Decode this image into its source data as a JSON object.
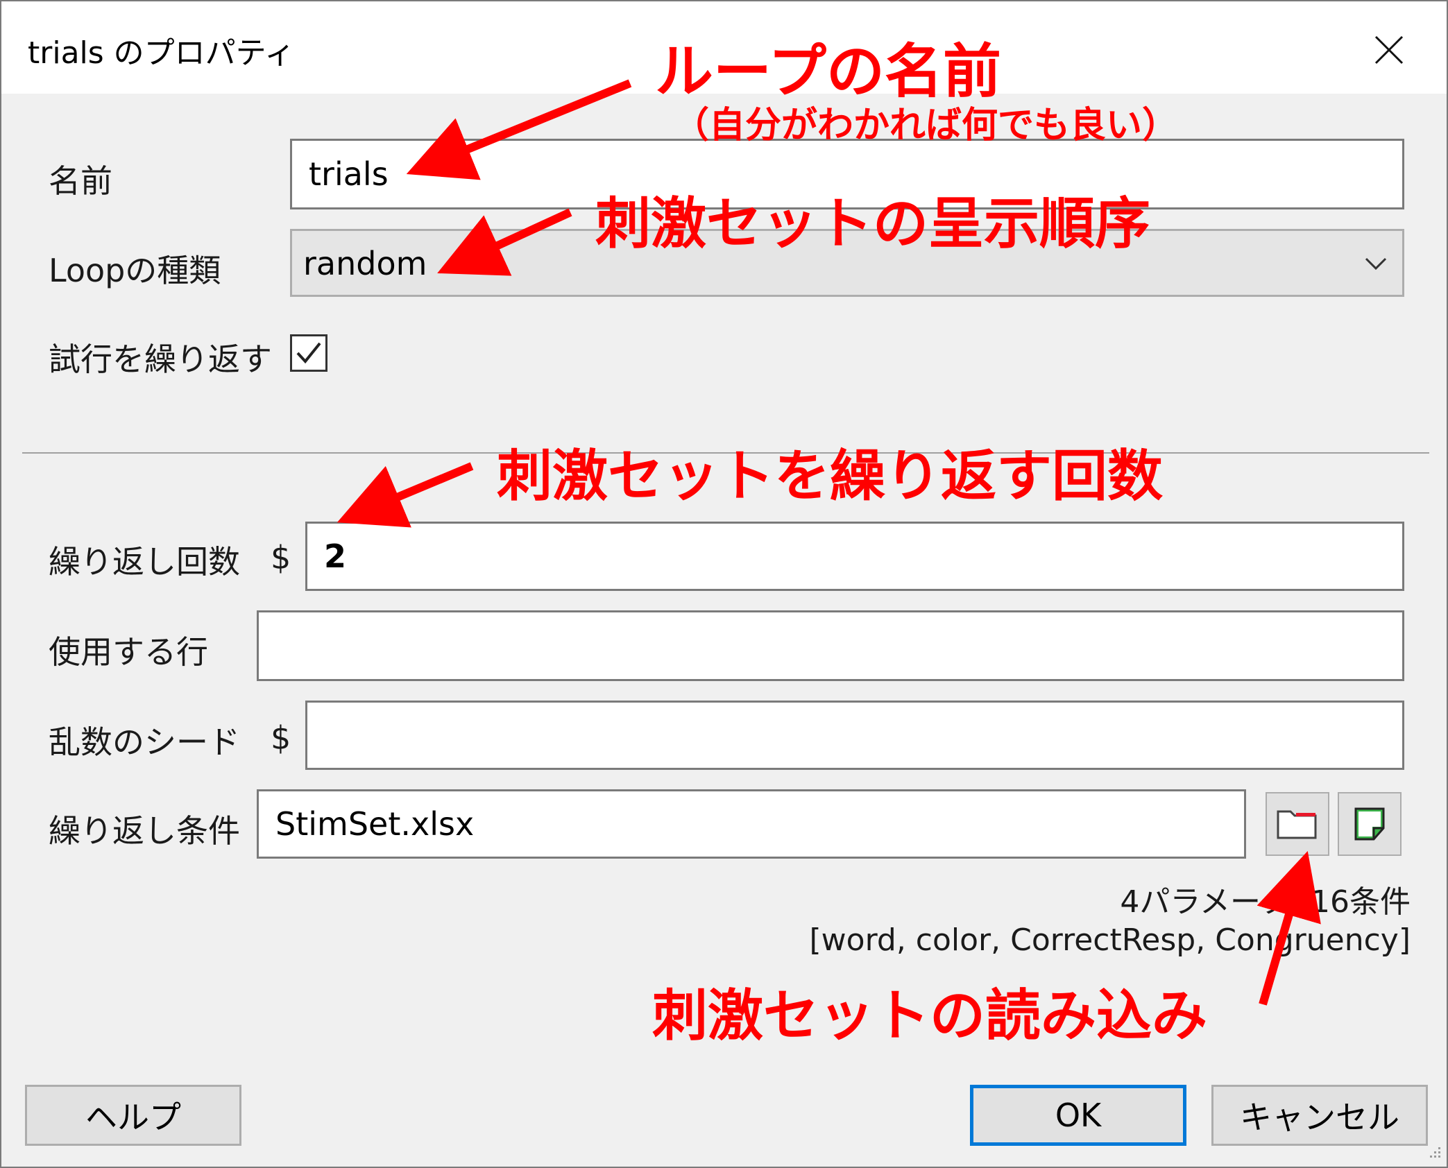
{
  "window": {
    "title": "trials のプロパティ"
  },
  "fields": {
    "name": {
      "label": "名前",
      "value": "trials"
    },
    "loop_type": {
      "label": "Loopの種類",
      "value": "random"
    },
    "repeat_trials": {
      "label": "試行を繰り返す",
      "checked": true
    },
    "nreps": {
      "label": "繰り返し回数",
      "dollar": "$",
      "value": "2"
    },
    "selected_rows": {
      "label": "使用する行",
      "value": ""
    },
    "random_seed": {
      "label": "乱数のシード",
      "dollar": "$",
      "value": ""
    },
    "conditions": {
      "label": "繰り返し条件",
      "value": "StimSet.xlsx"
    }
  },
  "conditions_info": {
    "summary": "4パラメータ, 16条件",
    "params": "[word, color, CorrectResp, Congruency]"
  },
  "buttons": {
    "help": "ヘルプ",
    "ok": "OK",
    "cancel": "キャンセル"
  },
  "icons": {
    "close": "close-icon",
    "dropdown": "chevron-down-icon",
    "check": "check-icon",
    "open_file": "folder-open-icon",
    "preview": "sticky-note-icon",
    "resize": "resize-grip-icon"
  },
  "annotations": {
    "loop_name": "ループの名前",
    "loop_name_note": "（自分がわかれば何でも良い）",
    "order": "刺激セットの呈示順序",
    "reps": "刺激セットを繰り返す回数",
    "load": "刺激セットの読み込み"
  },
  "colors": {
    "annotation": "#ff0000",
    "ok_border": "#0078d7",
    "dialog_bg": "#f0f0f0"
  }
}
